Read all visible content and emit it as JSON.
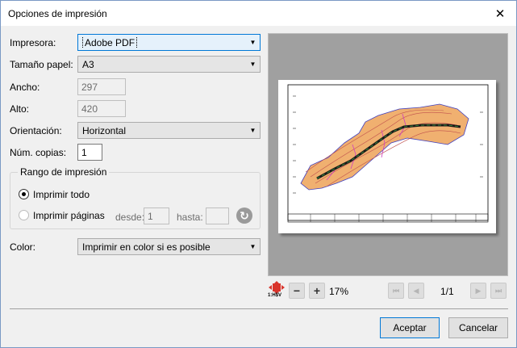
{
  "window": {
    "title": "Opciones de impresión",
    "close_glyph": "✕"
  },
  "form": {
    "printer_label": "Impresora:",
    "printer_value": "Adobe PDF",
    "paper_size_label": "Tamaño papel:",
    "paper_size_value": "A3",
    "width_label": "Ancho:",
    "width_value": "297",
    "height_label": "Alto:",
    "height_value": "420",
    "orientation_label": "Orientación:",
    "orientation_value": "Horizontal",
    "copies_label": "Núm. copias:",
    "copies_value": "1",
    "range": {
      "legend": "Rango de impresión",
      "print_all_label": "Imprimir todo",
      "print_pages_label": "Imprimir páginas",
      "from_label": "desde:",
      "from_value": "1",
      "to_label": "hasta:",
      "to_value": "",
      "selected": "print_all"
    },
    "color_label": "Color:",
    "color_value": "Imprimir en color si es posible"
  },
  "preview_toolbar": {
    "zoom_level": "17%",
    "page_indicator": "1/1",
    "fit_icon_caption": "1:H$V",
    "zoom_out_glyph": "−",
    "zoom_in_glyph": "+",
    "first_glyph": "⏮",
    "prev_glyph": "◀",
    "next_glyph": "▶",
    "last_glyph": "⏭"
  },
  "buttons": {
    "accept": "Aceptar",
    "cancel": "Cancelar"
  },
  "colors": {
    "accent": "#0078d7",
    "preview_bg": "#a0a0a0",
    "terrain_fill": "#f0b070",
    "contour": "#c0504d",
    "boundary": "#4040c0",
    "route": "#1a1a1a"
  }
}
